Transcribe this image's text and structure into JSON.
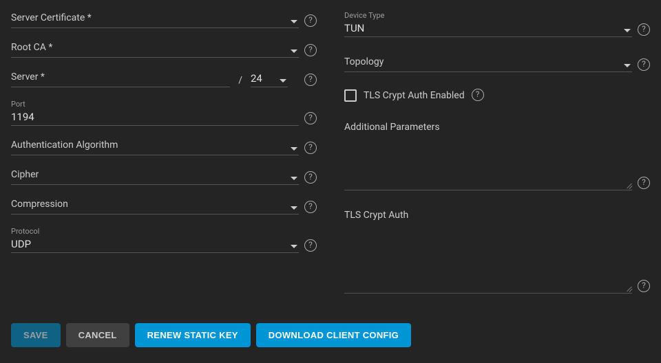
{
  "left": {
    "server_certificate": {
      "label": "Server Certificate *"
    },
    "root_ca": {
      "label": "Root CA *"
    },
    "server": {
      "label": "Server *",
      "cidr": "24"
    },
    "port": {
      "small_label": "Port",
      "value": "1194"
    },
    "auth_algo": {
      "label": "Authentication Algorithm"
    },
    "cipher": {
      "label": "Cipher"
    },
    "compression": {
      "label": "Compression"
    },
    "protocol": {
      "small_label": "Protocol",
      "value": "UDP"
    }
  },
  "right": {
    "device_type": {
      "small_label": "Device Type",
      "value": "TUN"
    },
    "topology": {
      "label": "Topology"
    },
    "tls_crypt_checkbox": {
      "label": "TLS Crypt Auth Enabled"
    },
    "additional_params": {
      "label": "Additional Parameters"
    },
    "tls_crypt_auth": {
      "label": "TLS Crypt Auth"
    }
  },
  "buttons": {
    "save": "SAVE",
    "cancel": "CANCEL",
    "renew": "RENEW STATIC KEY",
    "download": "DOWNLOAD CLIENT CONFIG"
  },
  "misc": {
    "slash": "/"
  }
}
